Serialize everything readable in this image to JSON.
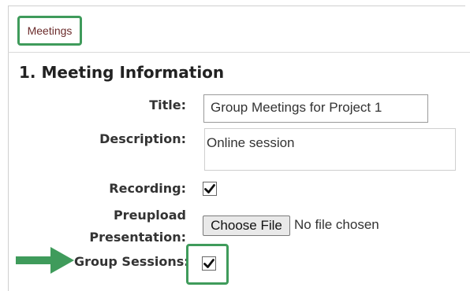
{
  "tabs": [
    {
      "label": "Meetings",
      "highlighted": true
    }
  ],
  "section": {
    "title": "1. Meeting Information"
  },
  "form": {
    "title": {
      "label": "Title:",
      "value": "Group Meetings for Project 1"
    },
    "description": {
      "label": "Description:",
      "value": "Online session"
    },
    "recording": {
      "label": "Recording:",
      "checked": true
    },
    "preupload": {
      "label_line1": "Preupload",
      "label_line2": "Presentation:",
      "button_label": "Choose File",
      "status": "No file chosen"
    },
    "group_sessions": {
      "label": "Group Sessions:",
      "checked": true,
      "highlighted": true
    }
  },
  "colors": {
    "highlight": "#3f9b5b",
    "tab_text": "#6b2b2b"
  },
  "icons": {
    "arrow": "arrow-right-icon",
    "check": "checkmark-icon"
  }
}
